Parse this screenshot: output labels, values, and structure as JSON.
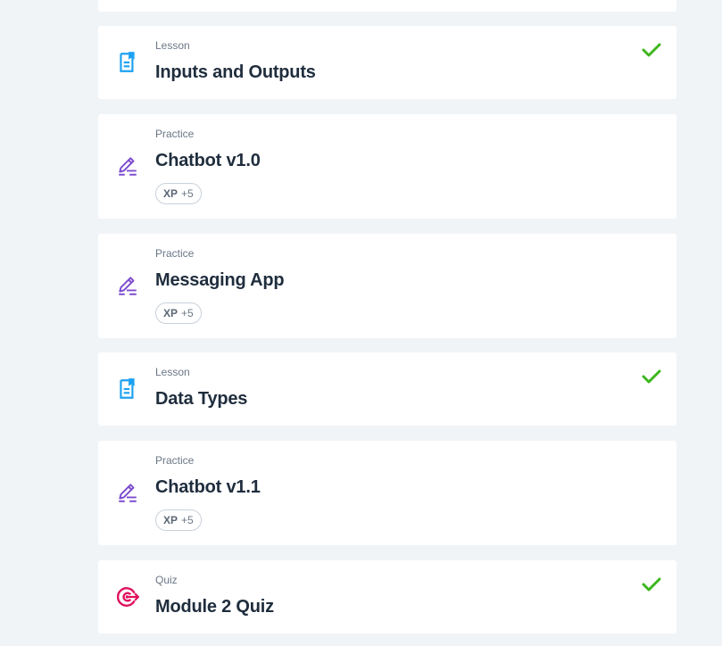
{
  "colors": {
    "background": "#f1f4f7",
    "card": "#ffffff",
    "lesson_icon": "#1da1f2",
    "practice_icon": "#7d4ccf",
    "quiz_icon": "#e0115f",
    "check": "#3db61d"
  },
  "items": [
    {
      "type": "Lesson",
      "title": "Inputs and Outputs",
      "icon": "document-icon",
      "completed": true
    },
    {
      "type": "Practice",
      "title": "Chatbot v1.0",
      "icon": "pencil-icon",
      "completed": false,
      "xp_label": "XP",
      "xp_value": "+5"
    },
    {
      "type": "Practice",
      "title": "Messaging App",
      "icon": "pencil-icon",
      "completed": false,
      "xp_label": "XP",
      "xp_value": "+5"
    },
    {
      "type": "Lesson",
      "title": "Data Types",
      "icon": "document-icon",
      "completed": true
    },
    {
      "type": "Practice",
      "title": "Chatbot v1.1",
      "icon": "pencil-icon",
      "completed": false,
      "xp_label": "XP",
      "xp_value": "+5"
    },
    {
      "type": "Quiz",
      "title": "Module 2 Quiz",
      "icon": "target-icon",
      "completed": true
    }
  ]
}
